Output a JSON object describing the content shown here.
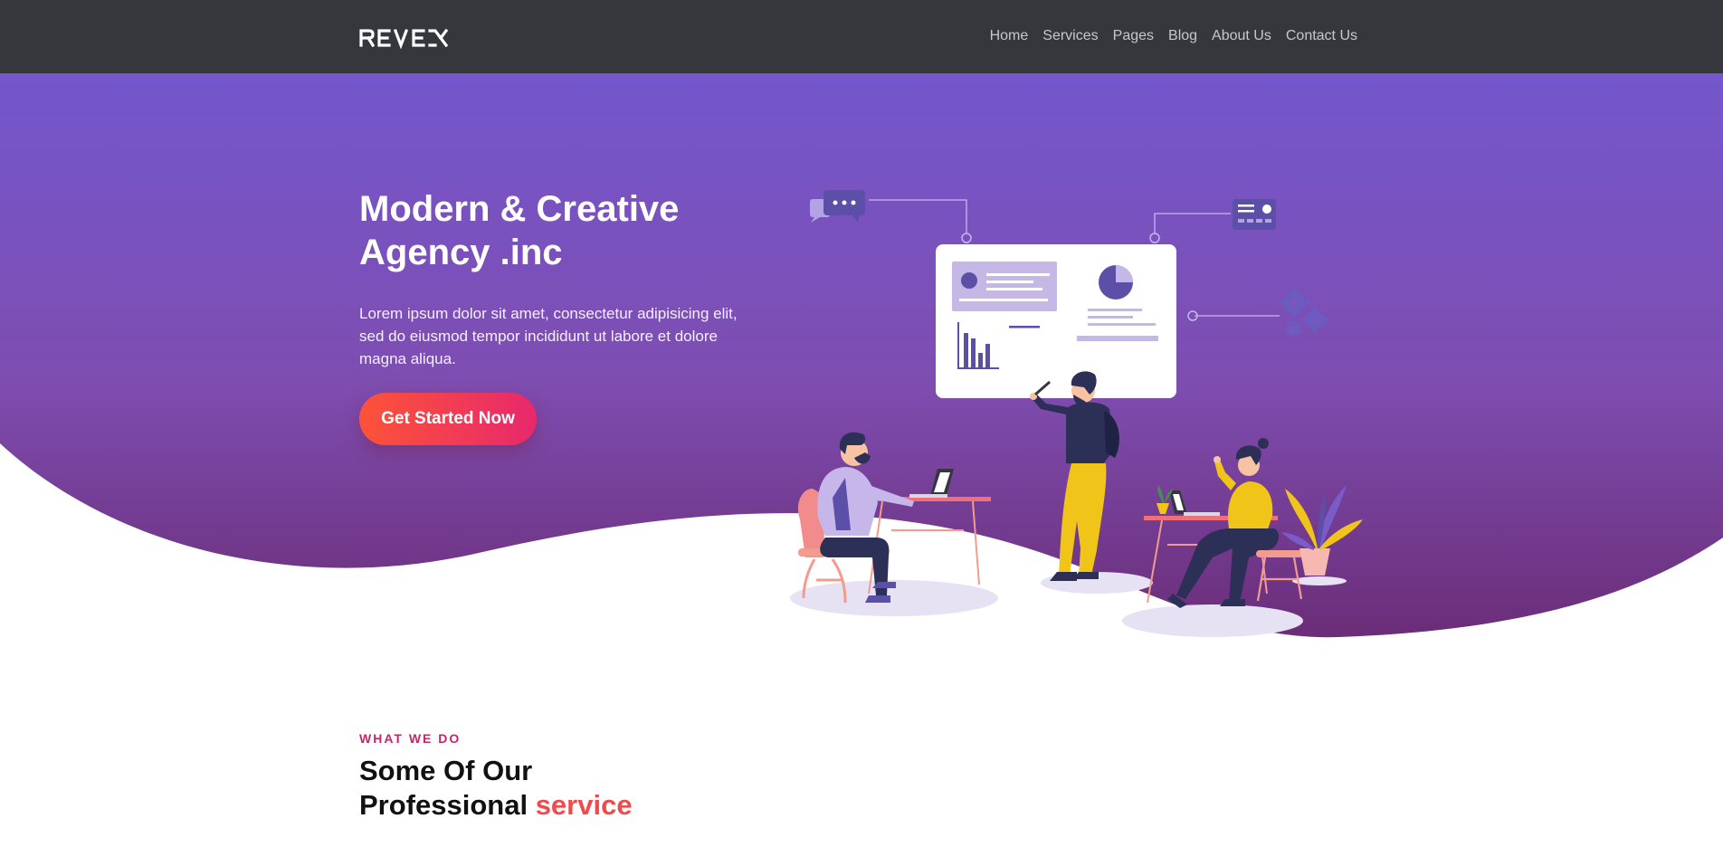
{
  "navbar": {
    "logo": "REVEX",
    "links": [
      "Home",
      "Services",
      "Pages",
      "Blog",
      "About Us",
      "Contact Us"
    ]
  },
  "hero": {
    "title_line1": "Modern & Creative",
    "title_line2": "Agency .inc",
    "description": "Lorem ipsum dolor sit amet, consectetur adipisicing elit, sed do eiusmod tempor incididunt ut labore et dolore magna aliqua.",
    "cta_label": "Get Started Now"
  },
  "services": {
    "eyebrow": "WHAT WE DO",
    "title_line1": "Some Of Our",
    "title_line2_prefix": "Professional",
    "title_line2_accent": "service"
  },
  "colors": {
    "navbar_bg": "#35373d",
    "hero_gradient_top": "#7457cc",
    "hero_gradient_bottom": "#6b2d78",
    "cta_gradient_start": "#fd5338",
    "cta_gradient_end": "#e7286d",
    "eyebrow": "#c0286e",
    "accent": "#f04b4c"
  },
  "icons": [
    "chat-bubble-icon",
    "id-card-icon",
    "gears-icon",
    "pie-chart-icon",
    "bar-chart-icon"
  ]
}
